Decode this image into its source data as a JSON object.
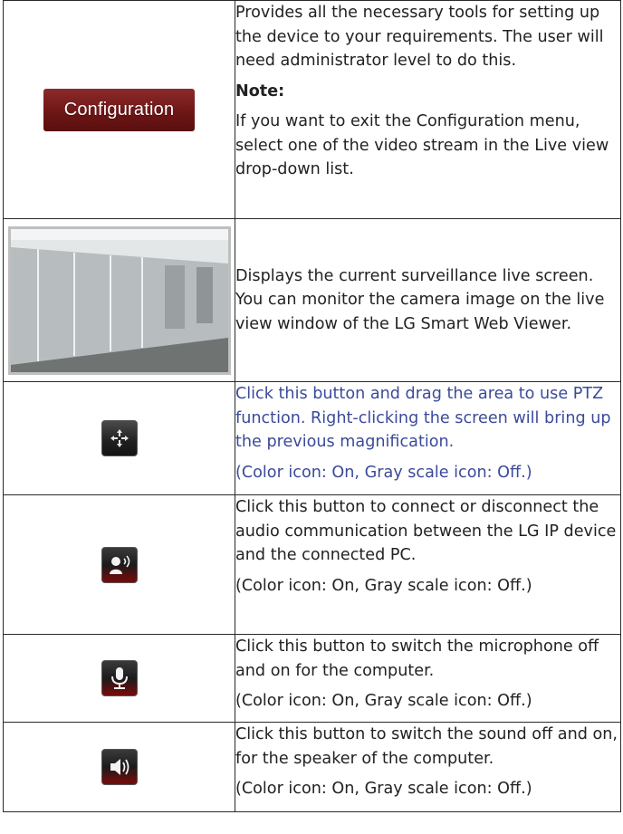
{
  "rows": [
    {
      "button_label": "Configuration",
      "paragraphs": [
        "Provides all the necessary tools for setting up the device to your requirements. The user will need administrator level to do this.",
        "Note:",
        "If you want to exit the Configuration menu, select one of the video stream in the Live view drop-down list."
      ]
    },
    {
      "icon": "live-view-thumbnail",
      "paragraphs": [
        "Displays the current surveillance live screen. You can monitor the camera image on the live view window of the LG Smart Web Viewer."
      ]
    },
    {
      "icon": "ptz-move-icon",
      "paragraphs": [
        "Click this button and drag the area to use PTZ function. Right-clicking the screen will bring up the previous magnification.",
        "(Color icon: On, Gray scale icon: Off.)"
      ]
    },
    {
      "icon": "audio-communication-icon",
      "paragraphs": [
        "Click this button to connect or disconnect the audio communication between the LG IP device and the connected PC.",
        "(Color icon: On, Gray scale icon: Off.)"
      ]
    },
    {
      "icon": "microphone-icon",
      "paragraphs": [
        "Click this button to switch the microphone off and on for the computer.",
        "(Color icon: On, Gray scale icon: Off.)"
      ]
    },
    {
      "icon": "speaker-icon",
      "paragraphs": [
        "Click this button to switch the sound off and on, for the speaker of the computer.",
        "(Color icon: On, Gray scale icon: Off.)"
      ]
    }
  ],
  "colors": {
    "border": "#2a2a2a",
    "config_button": "#7a1c1c",
    "link_text": "#3b4a9a"
  }
}
